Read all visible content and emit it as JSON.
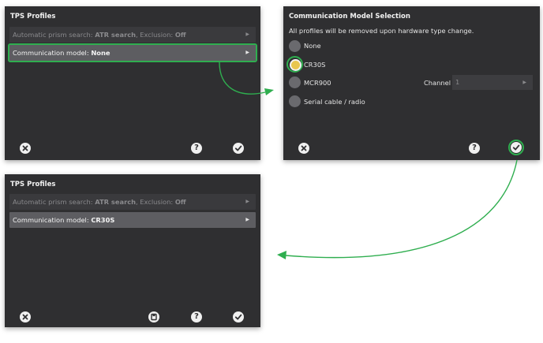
{
  "panel_tl": {
    "title": "TPS Profiles",
    "rows": [
      {
        "prefix": "Automatic prism search: ",
        "v1": "ATR search",
        "mid": ", Exclusion: ",
        "v2": "Off"
      },
      {
        "prefix": "Communication model: ",
        "v1": "None"
      }
    ]
  },
  "panel_tr": {
    "title": "Communication Model Selection",
    "subtitle": "All profiles will be removed upon hardware type change.",
    "options": [
      "None",
      "CR30S",
      "MCR900",
      "Serial cable / radio"
    ],
    "selected": "CR30S",
    "channel_label": "Channel",
    "channel_value": "1"
  },
  "panel_bl": {
    "title": "TPS Profiles",
    "rows": [
      {
        "prefix": "Automatic prism search: ",
        "v1": "ATR search",
        "mid": ", Exclusion: ",
        "v2": "Off"
      },
      {
        "prefix": "Communication model: ",
        "v1": "CR30S"
      }
    ]
  },
  "icons": {
    "cancel": "close-icon",
    "help": "help-icon",
    "confirm": "checkmark-icon",
    "save": "save-icon",
    "help_glyph": "?"
  },
  "colors": {
    "panel_bg": "#2f2f31",
    "row_active": "#5d5d61",
    "highlight": "#2fae4f",
    "selected_radio": "#e8c64f"
  }
}
